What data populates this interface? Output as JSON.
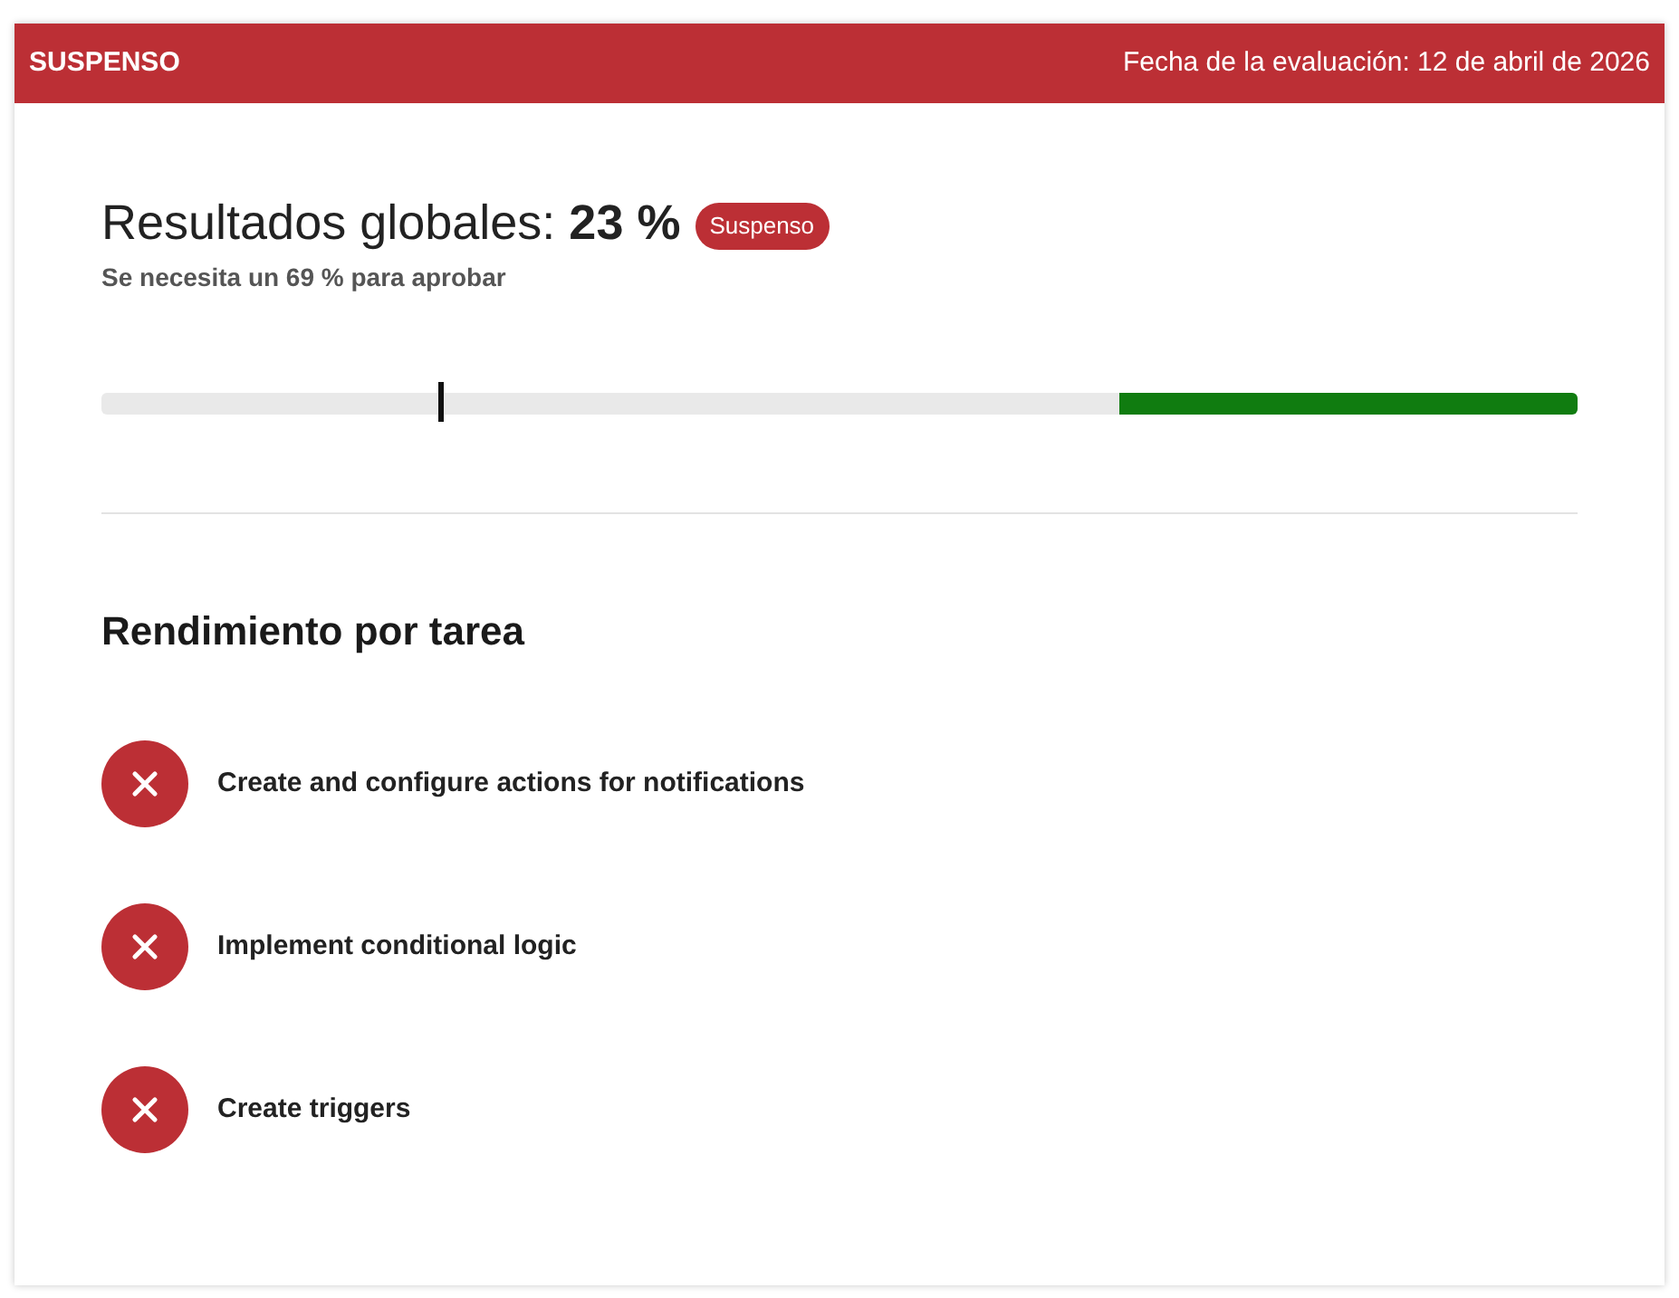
{
  "header": {
    "status": "SUSPENSO",
    "date": "Fecha de la evaluación: 12 de abril de 2026"
  },
  "results": {
    "title": "Resultados globales: **23 %**",
    "badge": "Suspenso",
    "passed": false,
    "requirement": "Se necesita un 69 % para aprobar"
  },
  "score_bar": {
    "marker": {
      "level": 0.23
    },
    "pass_zone": {
      "level": 0.31
    }
  },
  "tasks_section": {
    "heading": "Rendimiento por tarea"
  },
  "tasks": [
    {
      "name": "Create and configure actions for notifications",
      "passed": false
    },
    {
      "name": "Implement conditional logic",
      "passed": false
    },
    {
      "name": "Create triggers",
      "passed": false
    }
  ]
}
